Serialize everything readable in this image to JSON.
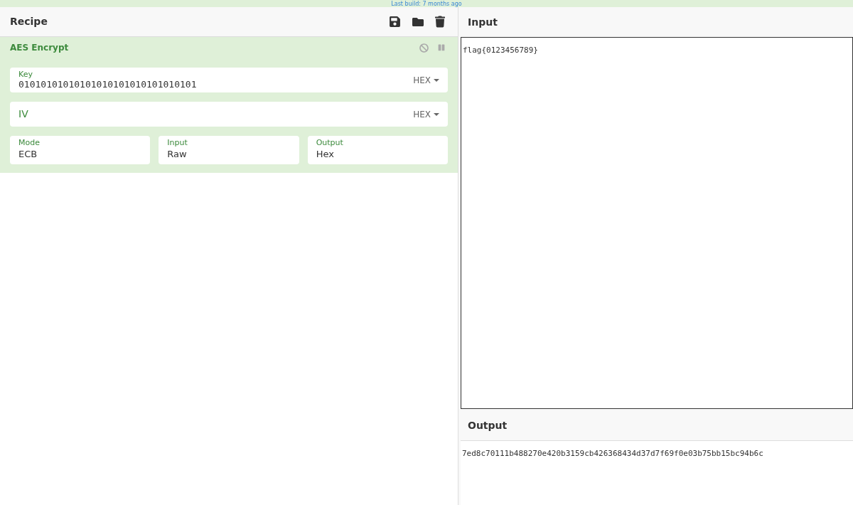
{
  "banner": {
    "text": "Last build: 7 months ago"
  },
  "recipe": {
    "title": "Recipe",
    "operations": [
      {
        "name": "AES Encrypt",
        "args": [
          {
            "kind": "toggle",
            "label": "Key",
            "value": "01010101010101010101010101010101",
            "option": "HEX"
          },
          {
            "kind": "toggle",
            "label": "IV",
            "option": "HEX"
          }
        ],
        "options": [
          {
            "label": "Mode",
            "value": "ECB"
          },
          {
            "label": "Input",
            "value": "Raw"
          },
          {
            "label": "Output",
            "value": "Hex"
          }
        ]
      }
    ]
  },
  "input": {
    "title": "Input",
    "value": "flag{0123456789}"
  },
  "output": {
    "title": "Output",
    "value": "7ed8c70111b488270e420b3159cb426368434d37d7f69f0e03b75bb15bc94b6c"
  }
}
